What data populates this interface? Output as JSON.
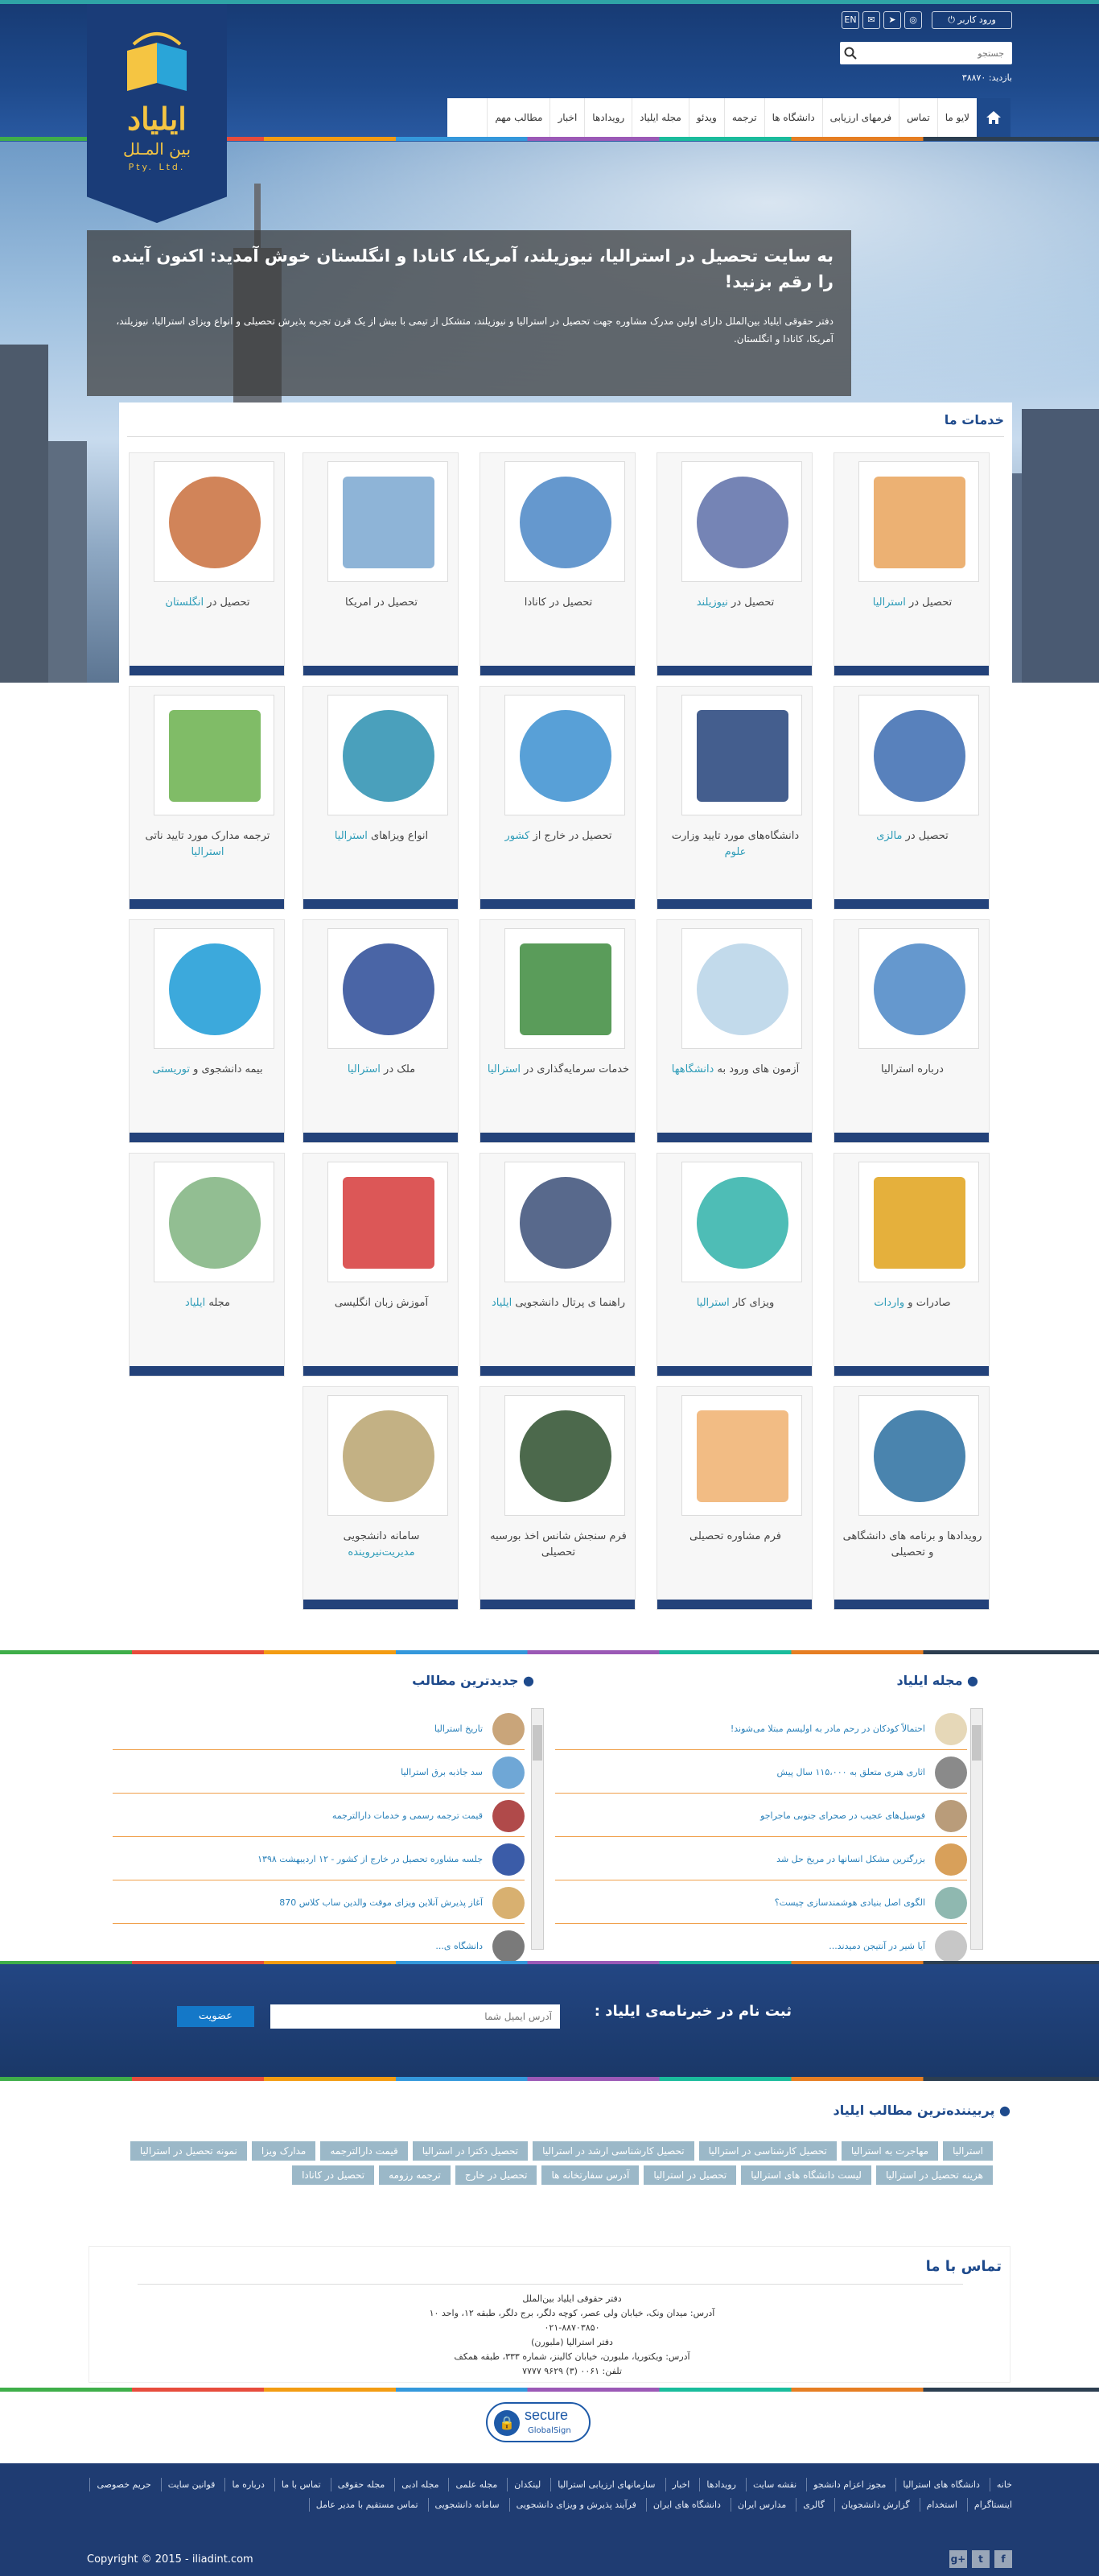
{
  "header": {
    "login_label": "ورود کاربر",
    "lang_label": "EN",
    "search_placeholder": "جستجو",
    "visits_text": "بازدید: ۳۸۸۷۰"
  },
  "logo": {
    "brand": "ایلیاد",
    "subtitle": "بین المـلل",
    "pty": "Pty. Ltd."
  },
  "nav": {
    "items": [
      "لایو ما",
      "تماس",
      "فرمهای ارزیابی",
      "دانشگاه ها",
      "ترجمه",
      "ویدئو",
      "مجله ایلیاد",
      "رویدادها",
      "اخبار",
      "مطالب مهم"
    ]
  },
  "hero": {
    "title": "به سایت تحصیل در استرالیا، نیوزیلند، آمریکا، کانادا و انگلستان خوش آمدید: اکنون آینده را رقم بزنید!",
    "text": "دفتر حقوقی ایلیاد بین‌الملل دارای اولین مدرک مشاوره جهت تحصیل در استرالیا و نیوزیلند، متشکل از تیمی با بیش از یک قرن تجربه پذیرش تحصیلی و انواع ویزای استرالیا، نیوزیلند، آمریکا، کانادا و انگلستان."
  },
  "services": {
    "title": "خدمات ما",
    "cards": [
      {
        "pre": "تحصیل در ",
        "hl": "استرالیا",
        "post": "",
        "icon": "sydney-opera-image"
      },
      {
        "pre": "تحصیل در ",
        "hl": "نیوزیلند",
        "post": "",
        "icon": "auckland-image"
      },
      {
        "pre": "تحصیل در کانادا",
        "hl": "",
        "post": "",
        "icon": "toronto-image"
      },
      {
        "pre": "تحصیل در امریکا",
        "hl": "",
        "post": "",
        "icon": "statue-of-liberty-image"
      },
      {
        "pre": "تحصیل در ",
        "hl": "انگلستان",
        "post": "",
        "icon": "london-image"
      },
      {
        "pre": "تحصیل در ",
        "hl": "مالزی",
        "post": "",
        "icon": "kuala-lumpur-image"
      },
      {
        "pre": "دانشگاه‌های مورد تایید وزارت ",
        "hl": "علوم",
        "post": "",
        "icon": "university-building-icon"
      },
      {
        "pre": "تحصیل در خارج از ",
        "hl": "کشور",
        "post": "",
        "icon": "globe-plane-icon"
      },
      {
        "pre": "انواع ویزاهای ",
        "hl": "استرالیا",
        "post": "",
        "icon": "passport-icon"
      },
      {
        "pre": "ترجمه مدارک مورد تایید ناتی ",
        "hl": "استرالیا",
        "post": "",
        "icon": "translation-bubbles-icon"
      },
      {
        "pre": "درباره استرالیا",
        "hl": "",
        "post": "",
        "icon": "sydney-skyline-icon"
      },
      {
        "pre": "آزمون های ورود به ",
        "hl": "دانشگاهها",
        "post": "",
        "icon": "exam-papers-icon"
      },
      {
        "pre": "خدمات سرمایه‌گذاری در ",
        "hl": "استرالیا",
        "post": "",
        "icon": "dollar-plant-icon"
      },
      {
        "pre": "ملک در ",
        "hl": "استرالیا",
        "post": "",
        "icon": "house-roof-icon"
      },
      {
        "pre": "بیمه دانشجوی و ",
        "hl": "توریستی",
        "post": "",
        "icon": "bupa-logo"
      },
      {
        "pre": "صادرات و ",
        "hl": "واردات",
        "post": "",
        "icon": "export-import-icon"
      },
      {
        "pre": "ویزای کار ",
        "hl": "استرالیا",
        "post": "",
        "icon": "professionals-icon"
      },
      {
        "pre": "راهنما ی پرتال دانشجویی ",
        "hl": "ایلیاد",
        "post": "",
        "icon": "certificate-people-icon"
      },
      {
        "pre": "آموزش زبان انگلیسی",
        "hl": "",
        "post": "",
        "icon": "english-text-icon"
      },
      {
        "pre": "مجله ",
        "hl": "ایلیاد",
        "post": "",
        "icon": "science-atom-icon"
      },
      {
        "pre": "رویدادها و برنامه های دانشگاهی و تحصیلی",
        "hl": "",
        "post": "",
        "icon": "calendar-clock-icon"
      },
      {
        "pre": "فرم مشاوره تحصیلی",
        "hl": "",
        "post": "",
        "icon": "tablet-checklist-icon"
      },
      {
        "pre": "فرم سنجش شانس اخذ بورسیه تحصیلی",
        "hl": "",
        "post": "",
        "icon": "scholarship-cap-icon"
      },
      {
        "pre": "سامانه دانشجویی ",
        "hl": "مدیریت‌نیروینده",
        "post": "",
        "icon": "folders-icon"
      }
    ]
  },
  "news": {
    "magazine_title": "مجله ایلیاد",
    "latest_title": "جدیدترین مطالب",
    "magazine_items": [
      "احتمالاً کودکان در رحم مادر به اولیسم مبتلا می‌شوند!",
      "اثاری هنری متعلق به ۱۱۵،۰۰۰ سال پیش",
      "فوسیل‌های عجیب در صحرای جنوبی ماجراجو",
      "بزرگترین مشکل انسانها در مریخ حل شد",
      "الگوی اصل بنیادی هوشمندسازی چیست؟",
      "آیا شیر در آنتیجن دمیدند..."
    ],
    "latest_items": [
      "تاریخ استرالیا",
      "سد جاذبه برق استرالیا",
      "قیمت ترجمه رسمی و خدمات دارالترجمه",
      "جلسه مشاوره تحصیل در خارج از کشور - ۱۲ اردیبهشت ۱۳۹۸",
      "آغاز پذیرش آنلاین ویزای موقت والدین ساب کلاس 870",
      "دانشگاه ی..."
    ]
  },
  "newsletter": {
    "title": "ثبت نام در خبرنامه‌ی ایلیاد :",
    "placeholder": "آدرس ایمیل شما",
    "button": "عضویت"
  },
  "tags": {
    "title": "پربیننده‌ترین مطالب ایلیاد",
    "items": [
      "استرالیا",
      "مهاجرت به استرالیا",
      "تحصیل کارشناسی در استرالیا",
      "تحصیل کارشناسی ارشد در استرالیا",
      "تحصیل دکترا در استرالیا",
      "قیمت دارالترجمه",
      "مدارک ویزا",
      "نمونه تحصیل در استرالیا",
      "هزینه تحصیل در استرالیا",
      "لیست دانشگاه های استرالیا",
      "تحصیل در استرالیا",
      "آدرس سفارتخانه ها",
      "تحصیل در خارج",
      "ترجمه رزومه",
      "تحصیل در کانادا"
    ]
  },
  "contact": {
    "title": "تماس با ما",
    "lines": [
      "دفتر حقوقی ایلیاد بین‌الملل",
      "آدرس: میدان ونک، خیابان ولی عصر، کوچه دلگر، برج دلگر، طبقه ۱۲، واحد ۱۰",
      "۰۲۱-۸۸۷۰۳۸۵۰",
      "دفتر استرالیا (ملبورن)",
      "آدرس: ویکتوریا، ملبورن، خیابان کالینز، شماره ۳۳۳، طبقه همکف",
      "تلفن: ۰۰۶۱ (۳) ۹۶۲۹ ۷۷۷۷"
    ]
  },
  "secure": {
    "label": "secure",
    "sub": "GlobalSign"
  },
  "footer": {
    "links": [
      "خانه",
      "دانشگاه های استرالیا",
      "مجوز اعزام دانشجو",
      "نقشه سایت",
      "رویدادها",
      "اخبار",
      "سازمانهای ارزیابی استرالیا",
      "لینکدان",
      "مجله علمی",
      "مجله ادبی",
      "مجله حقوقی",
      "تماس با ما",
      "درباره ما",
      "قوانین سایت",
      "حریم خصوصی",
      "اینستاگرام",
      "استخدام",
      "گزارش دانشجویان",
      "گالری",
      "مدارس ایران",
      "دانشگاه های ایران",
      "فرآیند پذیرش و ویزای دانشجویی",
      "سامانه دانشجویی",
      "تماس مستقیم با مدیر عامل"
    ],
    "copyright": "Copyright © 2015 - iliadint.com"
  }
}
